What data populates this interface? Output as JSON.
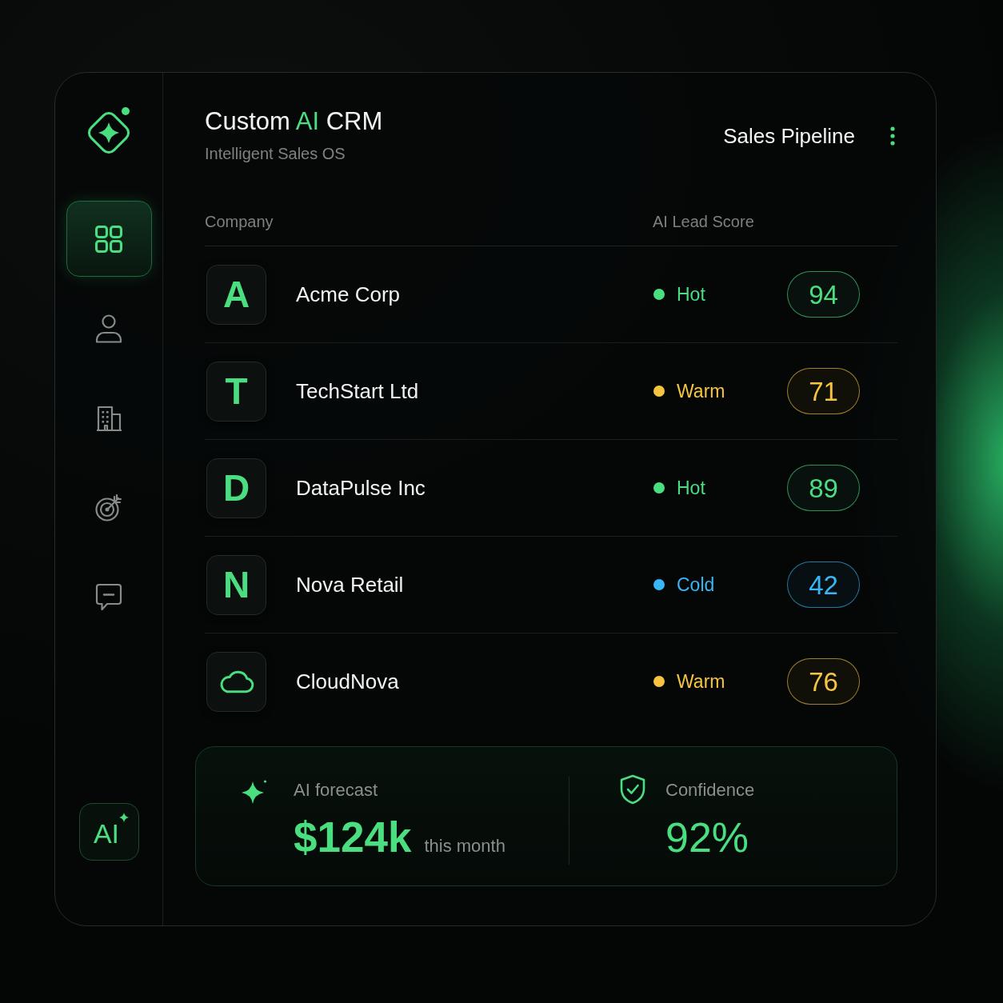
{
  "sidebar": {
    "nav": [
      {
        "selected": true
      },
      {
        "selected": false
      },
      {
        "selected": false
      },
      {
        "selected": false
      },
      {
        "selected": false
      }
    ],
    "ai_button": {
      "label": "AI"
    }
  },
  "header": {
    "title": [
      {
        "text": "Custom ",
        "accent": false
      },
      {
        "text": "AI",
        "accent": true
      },
      {
        "text": " CRM",
        "accent": false
      }
    ],
    "subtitle": "Intelligent Sales OS",
    "view_title": "Sales Pipeline"
  },
  "table": {
    "columns": [
      "Company",
      "AI Lead Score"
    ],
    "rows": [
      {
        "logo": {
          "kind": "letter",
          "text": "A"
        },
        "company": "Acme Corp",
        "status": "Hot",
        "color": "#4ade80",
        "score": "94"
      },
      {
        "logo": {
          "kind": "letter",
          "text": "T"
        },
        "company": "TechStart Ltd",
        "status": "Warm",
        "color": "#f5c542",
        "score": "71"
      },
      {
        "logo": {
          "kind": "letter",
          "text": "D"
        },
        "company": "DataPulse Inc",
        "status": "Hot",
        "color": "#4ade80",
        "score": "89"
      },
      {
        "logo": {
          "kind": "letter",
          "text": "N"
        },
        "company": "Nova Retail",
        "status": "Cold",
        "color": "#38b6f5",
        "score": "42"
      },
      {
        "logo": {
          "kind": "icon"
        },
        "company": "CloudNova",
        "status": "Warm",
        "color": "#f5c542",
        "score": "76"
      }
    ]
  },
  "summary": {
    "forecast": {
      "label": "AI forecast",
      "value": "$124k",
      "period": "this month"
    },
    "confidence": {
      "label": "Confidence",
      "value": "92%"
    }
  }
}
